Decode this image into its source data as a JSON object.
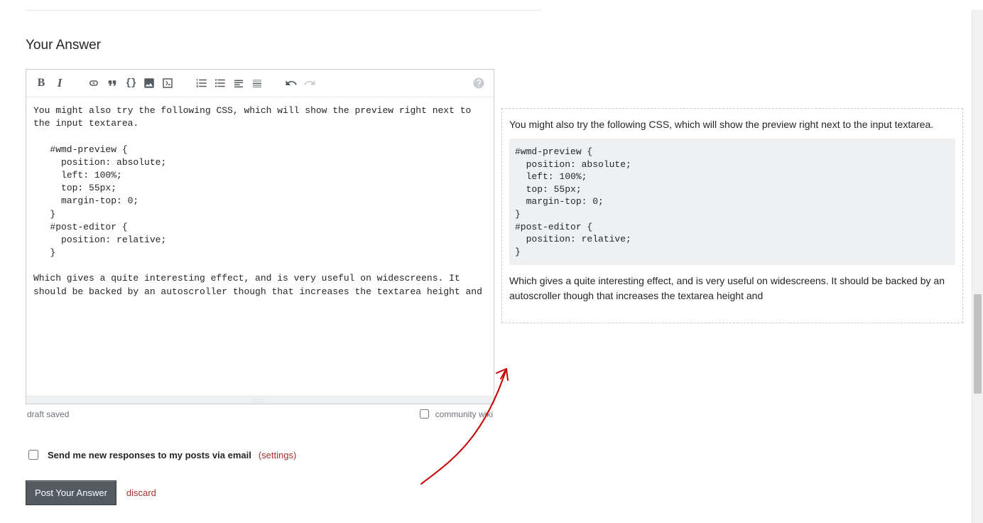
{
  "heading": "Your Answer",
  "toolbar": {
    "bold": "B",
    "italic": "I",
    "quote": "“”",
    "code": "{}"
  },
  "editor": {
    "raw": "You might also try the following CSS, which will show the preview right next to the input textarea.\n\n   #wmd-preview {\n     position: absolute;\n     left: 100%;\n     top: 55px;\n     margin-top: 0;\n   }\n   #post-editor {\n     position: relative;\n   }\n\nWhich gives a quite interesting effect, and is very useful on widescreens. It should be backed by an autoscroller though that increases the textarea height and"
  },
  "preview": {
    "para1": "You might also try the following CSS, which will show the preview right next to the input textarea.",
    "code": "#wmd-preview {\n  position: absolute;\n  left: 100%;\n  top: 55px;\n  margin-top: 0;\n}\n#post-editor {\n  position: relative;\n}",
    "para2": "Which gives a quite interesting effect, and is very useful on widescreens. It should be backed by an autoscroller though that increases the textarea height and"
  },
  "status": {
    "draft_saved": "draft saved",
    "community_wiki": "community wiki"
  },
  "notify": {
    "label": "Send me new responses to my posts via email",
    "settings": "(settings)"
  },
  "submit": {
    "post": "Post Your Answer",
    "discard": "discard"
  },
  "grippie": "::::::"
}
